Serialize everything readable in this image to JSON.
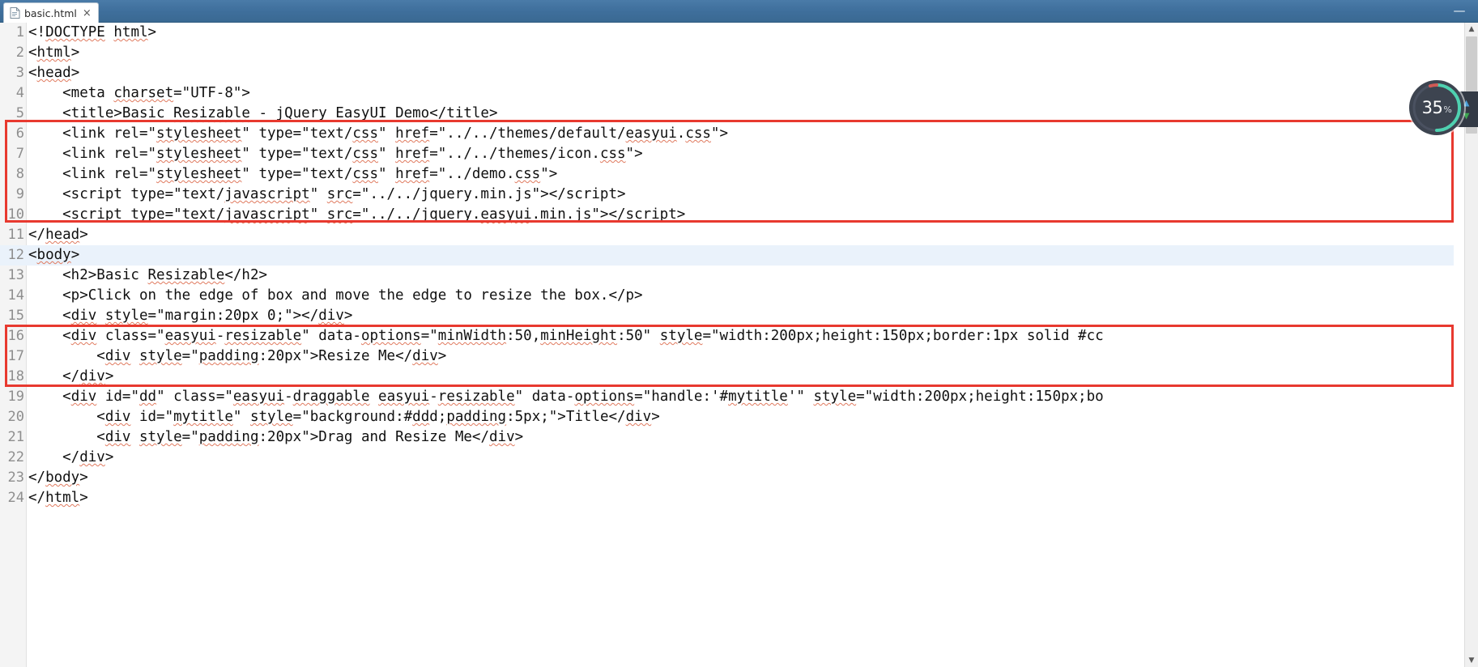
{
  "window": {
    "minimize_label": "—"
  },
  "tab": {
    "icon": "document-icon",
    "label": "basic.html",
    "close": "×"
  },
  "editor": {
    "current_line": 12,
    "lines": [
      {
        "n": "1",
        "text": "<!DOCTYPE html>"
      },
      {
        "n": "2",
        "text": "<html>"
      },
      {
        "n": "3",
        "text": "<head>"
      },
      {
        "n": "4",
        "text": "    <meta charset=\"UTF-8\">"
      },
      {
        "n": "5",
        "text": "    <title>Basic Resizable - jQuery EasyUI Demo</title>"
      },
      {
        "n": "6",
        "text": "    <link rel=\"stylesheet\" type=\"text/css\" href=\"../../themes/default/easyui.css\">"
      },
      {
        "n": "7",
        "text": "    <link rel=\"stylesheet\" type=\"text/css\" href=\"../../themes/icon.css\">"
      },
      {
        "n": "8",
        "text": "    <link rel=\"stylesheet\" type=\"text/css\" href=\"../demo.css\">"
      },
      {
        "n": "9",
        "text": "    <script type=\"text/javascript\" src=\"../../jquery.min.js\"></script>"
      },
      {
        "n": "10",
        "text": "    <script type=\"text/javascript\" src=\"../../jquery.easyui.min.js\"></script>"
      },
      {
        "n": "11",
        "text": "</head>"
      },
      {
        "n": "12",
        "text": "<body>"
      },
      {
        "n": "13",
        "text": "    <h2>Basic Resizable</h2>"
      },
      {
        "n": "14",
        "text": "    <p>Click on the edge of box and move the edge to resize the box.</p>"
      },
      {
        "n": "15",
        "text": "    <div style=\"margin:20px 0;\"></div>"
      },
      {
        "n": "16",
        "text": "    <div class=\"easyui-resizable\" data-options=\"minWidth:50,minHeight:50\" style=\"width:200px;height:150px;border:1px solid #cc"
      },
      {
        "n": "17",
        "text": "        <div style=\"padding:20px\">Resize Me</div>"
      },
      {
        "n": "18",
        "text": "    </div>"
      },
      {
        "n": "19",
        "text": "    <div id=\"dd\" class=\"easyui-draggable easyui-resizable\" data-options=\"handle:'#mytitle'\" style=\"width:200px;height:150px;bo"
      },
      {
        "n": "20",
        "text": "        <div id=\"mytitle\" style=\"background:#ddd;padding:5px;\">Title</div>"
      },
      {
        "n": "21",
        "text": "        <div style=\"padding:20px\">Drag and Resize Me</div>"
      },
      {
        "n": "22",
        "text": "    </div>"
      },
      {
        "n": "23",
        "text": "</body>"
      },
      {
        "n": "24",
        "text": "</html>"
      }
    ],
    "annotations": [
      {
        "name": "redbox-head-links",
        "label": "lines 6-10"
      },
      {
        "name": "redbox-resizable-div",
        "label": "lines 16-18"
      }
    ]
  },
  "progress_badge": {
    "value": "35",
    "unit": "%",
    "percent": 35,
    "arc_color": "#4fd1b0",
    "arc_accent": "#d05a55",
    "bg_color": "#3d4450",
    "up_arrow": "▲",
    "down_arrow": "▼"
  },
  "scrollbar": {
    "up_arrow": "▲",
    "down_arrow": "▼"
  }
}
